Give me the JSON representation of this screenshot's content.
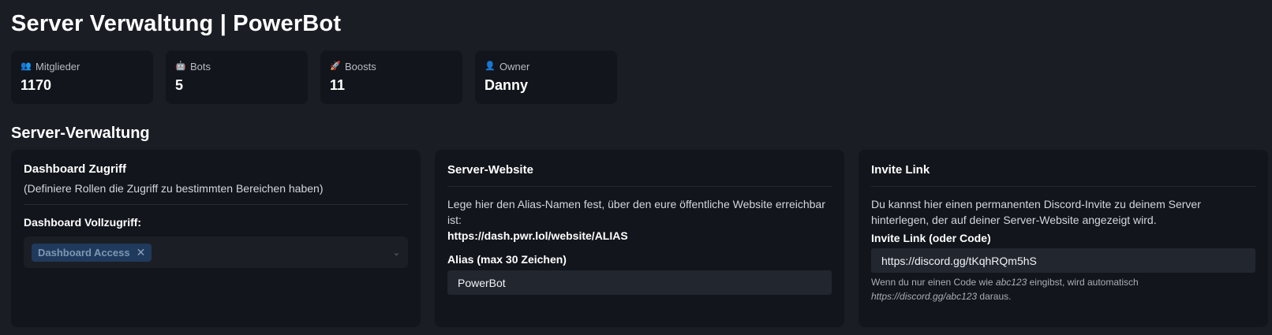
{
  "page": {
    "title": "Server Verwaltung | PowerBot"
  },
  "stats": [
    {
      "icon": "members-icon",
      "glyph": "👥",
      "label": "Mitglieder",
      "value": "1170"
    },
    {
      "icon": "bot-icon",
      "glyph": "🤖",
      "label": "Bots",
      "value": "5"
    },
    {
      "icon": "rocket-icon",
      "glyph": "🚀",
      "label": "Boosts",
      "value": "11"
    },
    {
      "icon": "owner-icon",
      "glyph": "👤",
      "label": "Owner",
      "value": "Danny"
    }
  ],
  "section": {
    "title": "Server-Verwaltung"
  },
  "dashboard_access": {
    "title": "Dashboard Zugriff",
    "subtitle": "(Definiere Rollen die Zugriff zu bestimmten Bereichen haben)",
    "field_label": "Dashboard Vollzugriff:",
    "selected_chip": "Dashboard Access",
    "chip_close": "✕",
    "chevron": "⌄"
  },
  "server_website": {
    "title": "Server-Website",
    "description": "Lege hier den Alias-Namen fest, über den eure öffentliche Website erreichbar ist:",
    "url": "https://dash.pwr.lol/website/ALIAS",
    "field_label": "Alias (max 30 Zeichen)",
    "value": "PowerBot"
  },
  "invite_link": {
    "title": "Invite Link",
    "description": "Du kannst hier einen permanenten Discord-Invite zu deinem Server hinterlegen, der auf deiner Server-Website angezeigt wird.",
    "field_label": "Invite Link (oder Code)",
    "value": "https://discord.gg/tKqhRQm5hS",
    "hint_prefix": "Wenn du nur einen Code wie ",
    "hint_code": "abc123",
    "hint_middle": " eingibst, wird automatisch",
    "hint_url": "https://discord.gg/abc123",
    "hint_suffix": " daraus."
  }
}
